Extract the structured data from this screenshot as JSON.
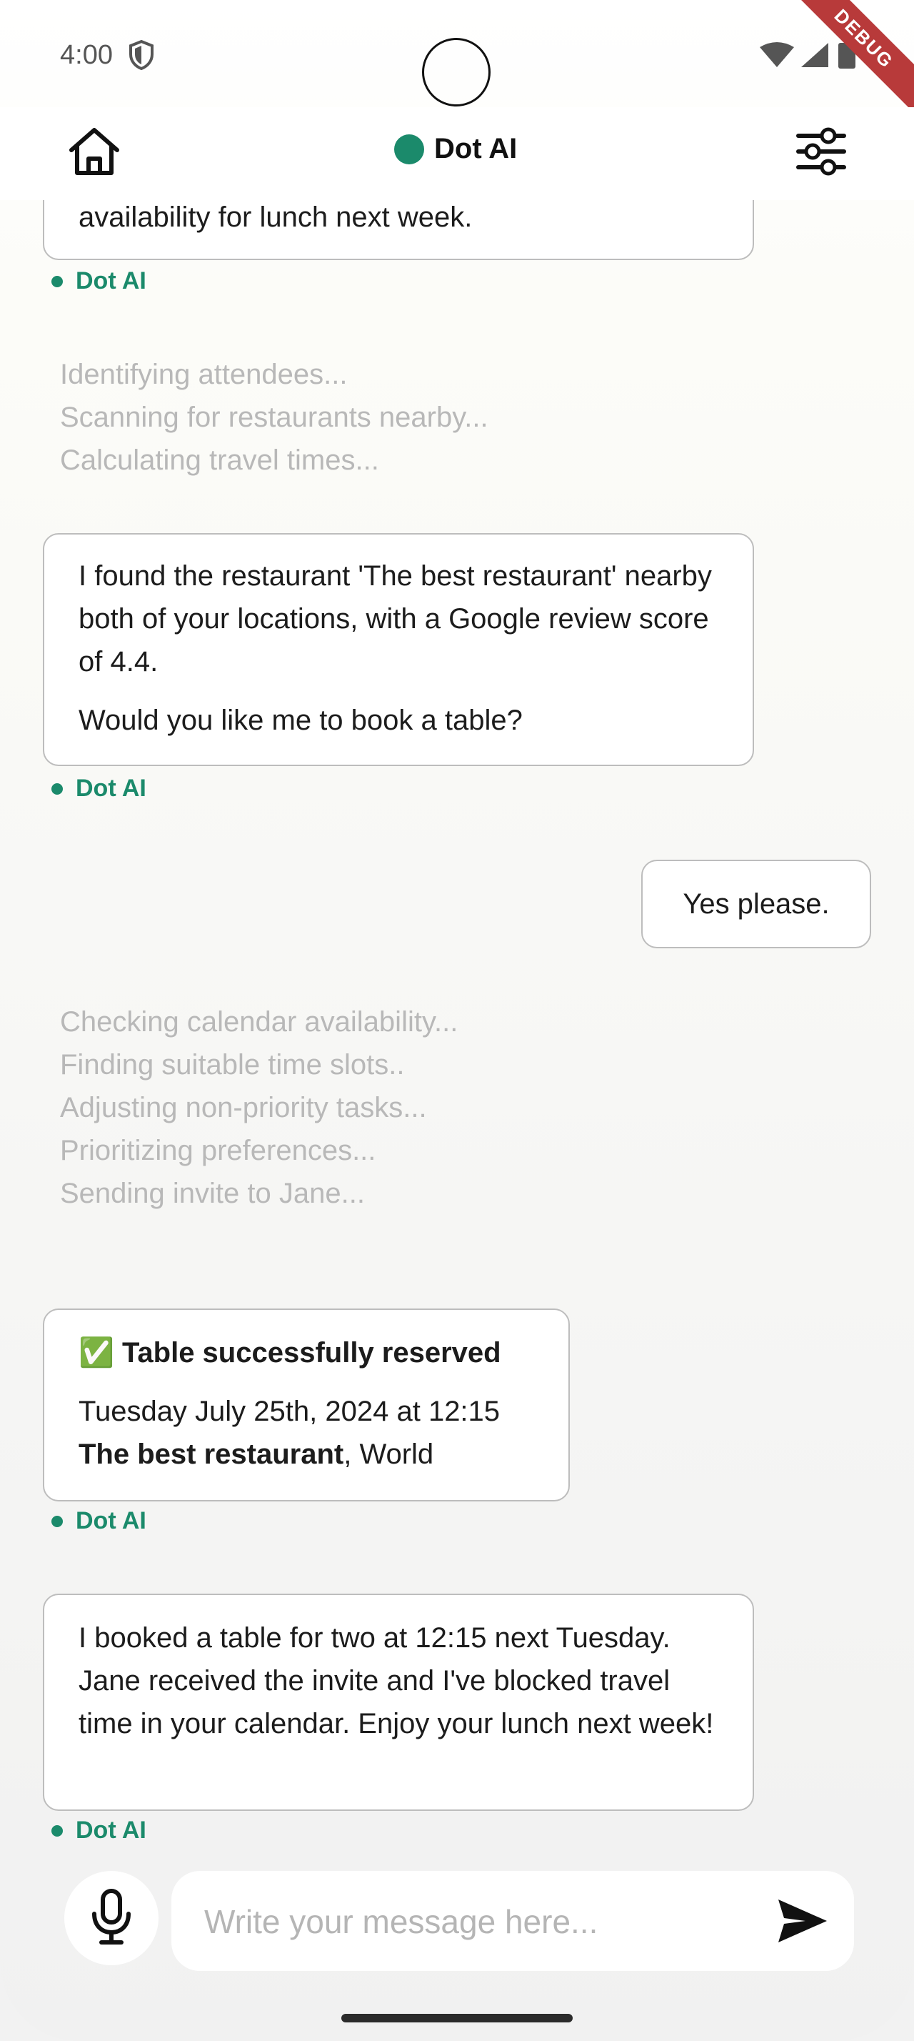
{
  "status_bar": {
    "time": "4:00",
    "debug_label": "DEBUG"
  },
  "app_bar": {
    "title": "Dot AI"
  },
  "messages": {
    "top_partial": {
      "text": "availability for lunch next week.",
      "sender": "Dot AI"
    },
    "thinking_1": [
      "Identifying attendees...",
      "Scanning for restaurants nearby...",
      "Calculating travel times..."
    ],
    "restaurant": {
      "paragraph_1": "I found the restaurant 'The best restaurant' nearby both of your locations, with a Google review score of 4.4.",
      "paragraph_2": "Would you like me to book a table?",
      "sender": "Dot AI"
    },
    "user_reply": {
      "text": "Yes please."
    },
    "thinking_2": [
      "Checking calendar availability...",
      "Finding suitable time slots..",
      "Adjusting non-priority tasks...",
      "Prioritizing preferences...",
      "Sending invite to Jane..."
    ],
    "reservation": {
      "check_emoji": "✅",
      "heading": "Table successfully reserved",
      "datetime": "Tuesday July 25th, 2024 at 12:15",
      "restaurant_name": "The best restaurant",
      "location": ", World",
      "sender": "Dot AI"
    },
    "final": {
      "text": "I booked a table for two at 12:15 next Tuesday. Jane received the invite and I've blocked travel time in your calendar. Enjoy your lunch next week!",
      "sender": "Dot AI"
    }
  },
  "composer": {
    "placeholder": "Write your message here..."
  },
  "colors": {
    "brand": "#1b8a6b",
    "thinking_text": "#b8b8b8",
    "bubble_border": "#bdbdbd"
  },
  "icons": {
    "home": "home-icon",
    "settings": "sliders-icon",
    "mic": "mic-icon",
    "send": "send-icon"
  }
}
